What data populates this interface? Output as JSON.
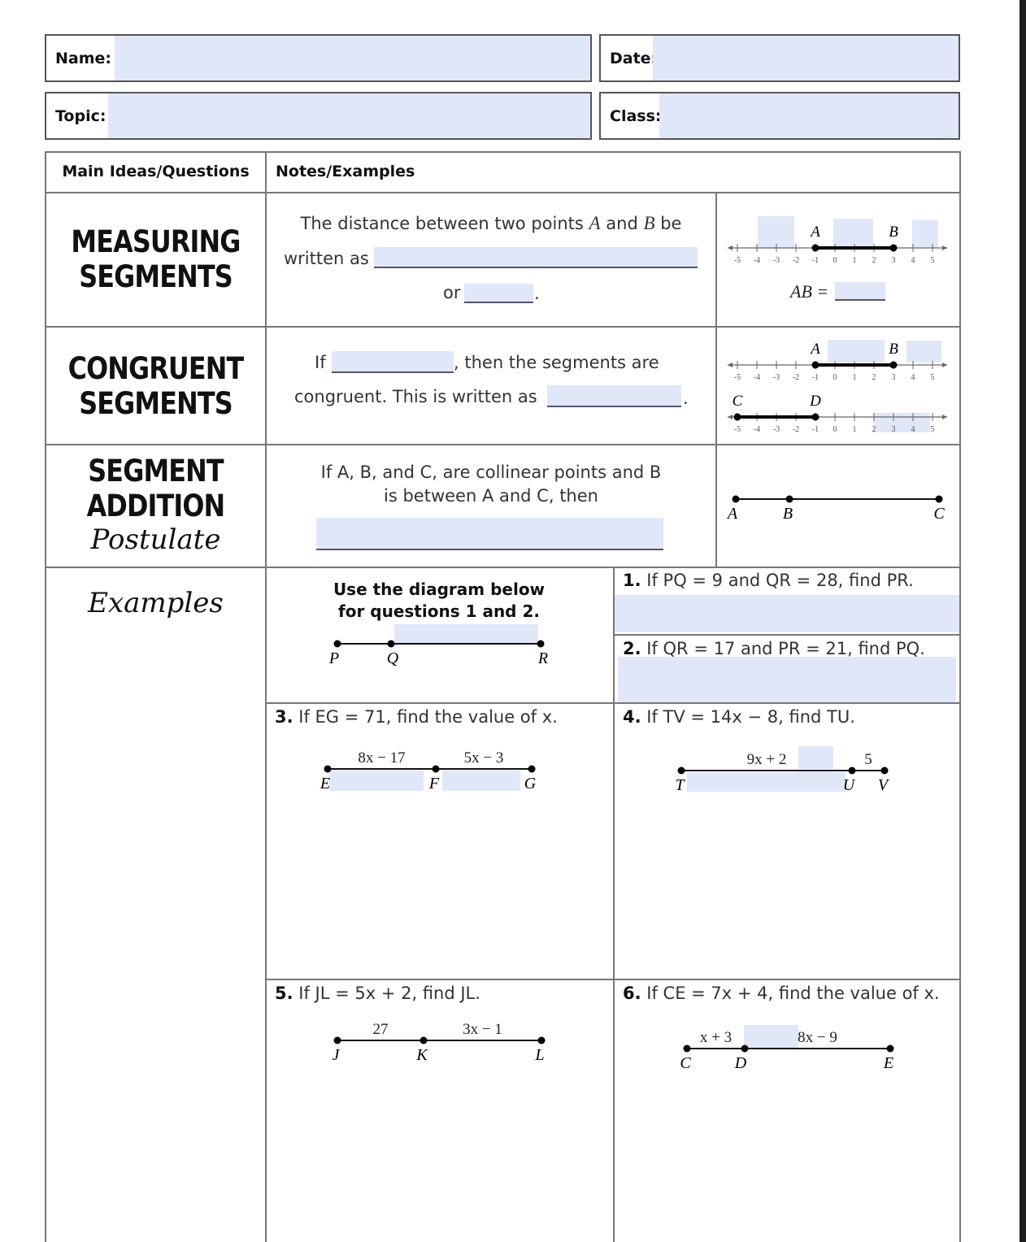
{
  "header": {
    "name_label": "Name:",
    "date_label": "Date:",
    "topic_label": "Topic:",
    "class_label": "Class:"
  },
  "table": {
    "col1_header": "Main Ideas/Questions",
    "col2_header": "Notes/Examples"
  },
  "sections": {
    "measuring": {
      "title_line1": "MEASURING",
      "title_line2": "SEGMENTS",
      "text1": "The distance between two points",
      "var_a": "A",
      "and": "and",
      "var_b": "B",
      "be": "be",
      "written_as": "written as",
      "or": "or",
      "period": ".",
      "ab_equals": "AB ="
    },
    "congruent": {
      "title_line1": "CONGRUENT",
      "title_line2": "SEGMENTS",
      "if": "If",
      "then_text": ", then the segments are",
      "congruent_text": "congruent.  This is written as",
      "period": "."
    },
    "addition": {
      "title_line1": "SEGMENT",
      "title_line2": "ADDITION",
      "title_line3": "Postulate",
      "line1": "If A, B, and C, are collinear points and B",
      "line2": "is between A and C, then",
      "points": [
        "A",
        "B",
        "C"
      ]
    }
  },
  "number_line": {
    "ticks": [
      "-5",
      "-4",
      "-3",
      "-2",
      "-1",
      "0",
      "1",
      "2",
      "3",
      "4",
      "5"
    ],
    "ab": {
      "a_label": "A",
      "a_value": -1,
      "b_label": "B",
      "b_value": 3
    },
    "cd": {
      "c_label": "C",
      "c_value": -5,
      "d_label": "D",
      "d_value": -1
    }
  },
  "examples": {
    "title": "Examples",
    "diagram_caption_line1": "Use the diagram below",
    "diagram_caption_line2": "for questions 1 and 2.",
    "pqr_points": [
      "P",
      "Q",
      "R"
    ],
    "q1": {
      "num": "1.",
      "text": " If PQ = 9 and QR = 28, find PR."
    },
    "q2": {
      "num": "2.",
      "text": " If QR = 17 and PR = 21, find PQ."
    },
    "q3": {
      "num": "3.",
      "text": " If EG = 71, find the value of x.",
      "points": [
        "E",
        "F",
        "G"
      ],
      "seg1": "8x − 17",
      "seg2": "5x − 3"
    },
    "q4": {
      "num": "4.",
      "text": " If TV = 14x − 8, find TU.",
      "points": [
        "T",
        "U",
        "V"
      ],
      "seg1": "9x + 2",
      "seg2": "5"
    },
    "q5": {
      "num": "5.",
      "text": "  If JL = 5x + 2, find JL.",
      "points": [
        "J",
        "K",
        "L"
      ],
      "seg1": "27",
      "seg2": "3x − 1"
    },
    "q6": {
      "num": "6.",
      "text": " If CE = 7x + 4, find the value of x.",
      "points": [
        "C",
        "D",
        "E"
      ],
      "seg1": "x + 3",
      "seg2": "8x − 9"
    }
  },
  "colors": {
    "field_fill": "#dfe7f8",
    "border": "#777777"
  }
}
